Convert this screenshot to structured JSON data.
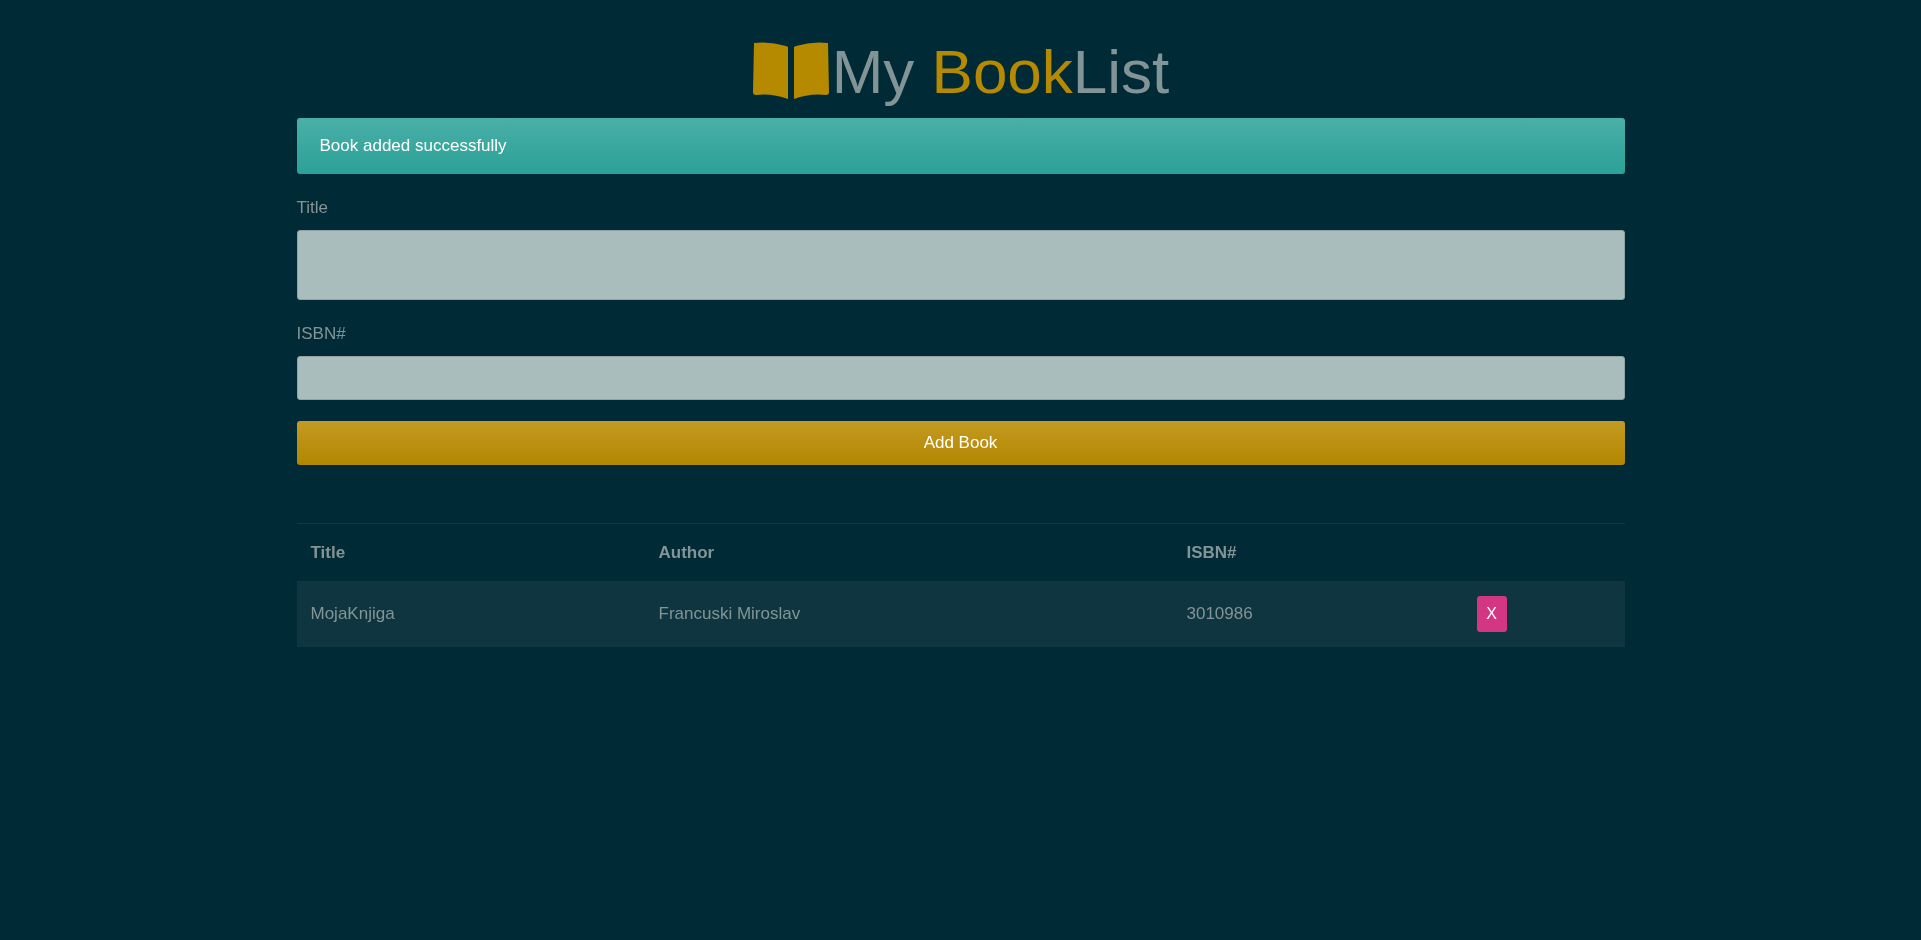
{
  "header": {
    "title_parts": [
      {
        "text": "My ",
        "highlight": false
      },
      {
        "text": "Book",
        "highlight": true
      },
      {
        "text": "List",
        "highlight": false
      }
    ]
  },
  "alert": {
    "kind": "success",
    "text": "Book added successfully"
  },
  "form": {
    "fields": [
      {
        "label": "Title",
        "kind": "tall"
      },
      {
        "label": "ISBN#",
        "kind": "short"
      }
    ],
    "submit": "Add Book"
  },
  "table": {
    "columns": [
      "Title",
      "Author",
      "ISBN#"
    ],
    "rows": [
      {
        "cells": [
          "MojaKnjiga",
          "Francuski Miroslav",
          "3010986"
        ],
        "delete": "X"
      }
    ]
  }
}
